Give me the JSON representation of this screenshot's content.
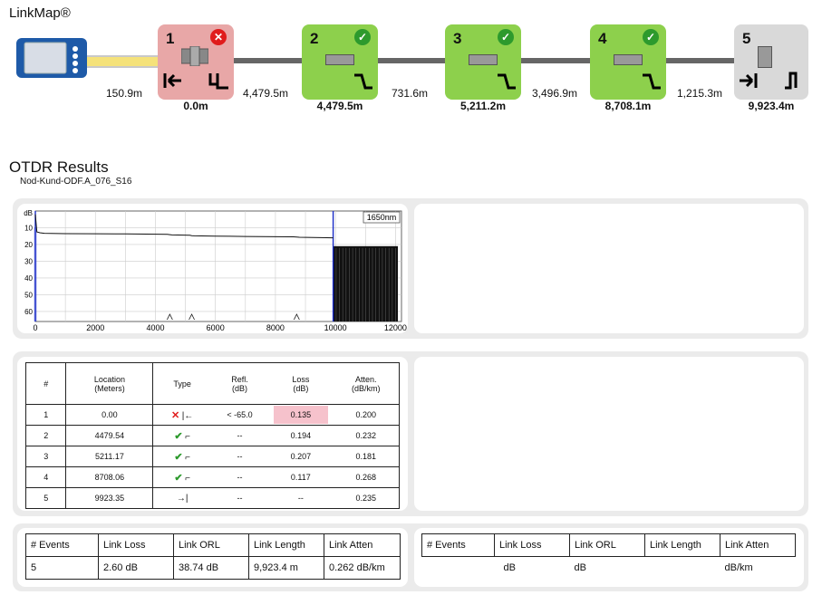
{
  "linkmap": {
    "title": "LinkMap®",
    "events": [
      {
        "num": "1",
        "status": "fail",
        "badge": "✕",
        "location": "0.0m"
      },
      {
        "num": "2",
        "status": "pass",
        "badge": "✓",
        "location": "4,479.5m"
      },
      {
        "num": "3",
        "status": "pass",
        "badge": "✓",
        "location": "5,211.2m"
      },
      {
        "num": "4",
        "status": "pass",
        "badge": "✓",
        "location": "8,708.1m"
      },
      {
        "num": "5",
        "status": "end",
        "badge": "",
        "location": "9,923.4m"
      }
    ],
    "segments": [
      "150.9m",
      "4,479.5m",
      "731.6m",
      "3,496.9m",
      "1,215.3m"
    ],
    "colors": {
      "fail": "#e8a7a7",
      "pass": "#8dd04c",
      "end": "#d9d9d9",
      "fiber": "#666666",
      "launch": "#f5e27a"
    }
  },
  "otdr": {
    "title": "OTDR Results",
    "subtitle": "Nod-Kund-ODF.A_076_S16"
  },
  "chart_data": {
    "type": "line",
    "legend": "1650nm",
    "ylabel": "dB",
    "y_ticks": [
      "10",
      "20",
      "30",
      "40",
      "50",
      "60"
    ],
    "x_ticks": [
      "0",
      "2000",
      "4000",
      "6000",
      "8000",
      "10000",
      "12000"
    ],
    "xlim": [
      0,
      12200
    ],
    "ylim": [
      0,
      66
    ],
    "y_inverted": true,
    "series": [
      {
        "x": [
          0,
          50,
          150,
          300,
          1000,
          2000,
          3000,
          4400,
          4480,
          4550,
          5150,
          5211,
          5300,
          6000,
          7000,
          8600,
          8708,
          8800,
          9500,
          9923
        ],
        "y": [
          2,
          12.5,
          13,
          13.3,
          13.5,
          13.6,
          13.7,
          13.9,
          14.1,
          14.3,
          14.5,
          14.7,
          14.8,
          15.0,
          15.2,
          15.4,
          15.6,
          15.7,
          15.9,
          16.0
        ]
      }
    ],
    "noise_floor_start": 9923,
    "noise_floor_level": 21,
    "event_markers_x": [
      4480,
      5211,
      8708
    ]
  },
  "events_table": {
    "headers": [
      "#",
      "Location\n(Meters)",
      "Type",
      "Refl.\n(dB)",
      "Loss\n(dB)",
      "Atten.\n(dB/km)"
    ],
    "rows": [
      {
        "num": "1",
        "location": "0.00",
        "type": "x-start",
        "refl": "< -65.0",
        "loss": "0.135",
        "atten": "0.200",
        "fail": true
      },
      {
        "num": "2",
        "location": "4479.54",
        "type": "check-splice",
        "refl": "--",
        "loss": "0.194",
        "atten": "0.232"
      },
      {
        "num": "3",
        "location": "5211.17",
        "type": "check-splice",
        "refl": "--",
        "loss": "0.207",
        "atten": "0.181"
      },
      {
        "num": "4",
        "location": "8708.06",
        "type": "check-splice",
        "refl": "--",
        "loss": "0.117",
        "atten": "0.268"
      },
      {
        "num": "5",
        "location": "9923.35",
        "type": "end",
        "refl": "--",
        "loss": "--",
        "atten": "0.235"
      }
    ]
  },
  "summary": {
    "headers": [
      "# Events",
      "Link Loss",
      "Link ORL",
      "Link Length",
      "Link Atten"
    ],
    "values": [
      "5",
      "2.60 dB",
      "38.74 dB",
      "9,923.4 m",
      "0.262 dB/km"
    ]
  },
  "summary2": {
    "headers": [
      "# Events",
      "Link Loss",
      "Link ORL",
      "Link Length",
      "Link Atten"
    ],
    "values": [
      "",
      "dB",
      "dB",
      "",
      "dB/km"
    ]
  }
}
